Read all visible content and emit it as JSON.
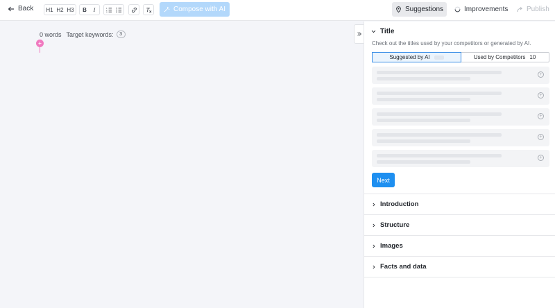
{
  "toolbar": {
    "back_label": "Back",
    "headings": [
      "H1",
      "H2",
      "H3"
    ],
    "format": {
      "bold": "B",
      "italic": "I"
    },
    "compose_label": "Compose with AI",
    "suggestions_label": "Suggestions",
    "improvements_label": "Improvements",
    "publish_label": "Publish"
  },
  "editor": {
    "word_count": "0 words",
    "target_keywords_label": "Target keywords:",
    "target_keywords_count": "3"
  },
  "panel": {
    "title_section": {
      "label": "Title",
      "description": "Check out the titles used by your competitors or generated by AI.",
      "tabs": [
        {
          "label": "Suggested by AI",
          "count": ""
        },
        {
          "label": "Used by Competitors",
          "count": "10"
        }
      ],
      "next_label": "Next"
    },
    "sections": [
      "Introduction",
      "Structure",
      "Images",
      "Facts and data"
    ]
  },
  "colors": {
    "accent": "#1e8ff0",
    "compose_disabled": "#b3d8fb",
    "cursor_marker": "#f07ac0"
  }
}
